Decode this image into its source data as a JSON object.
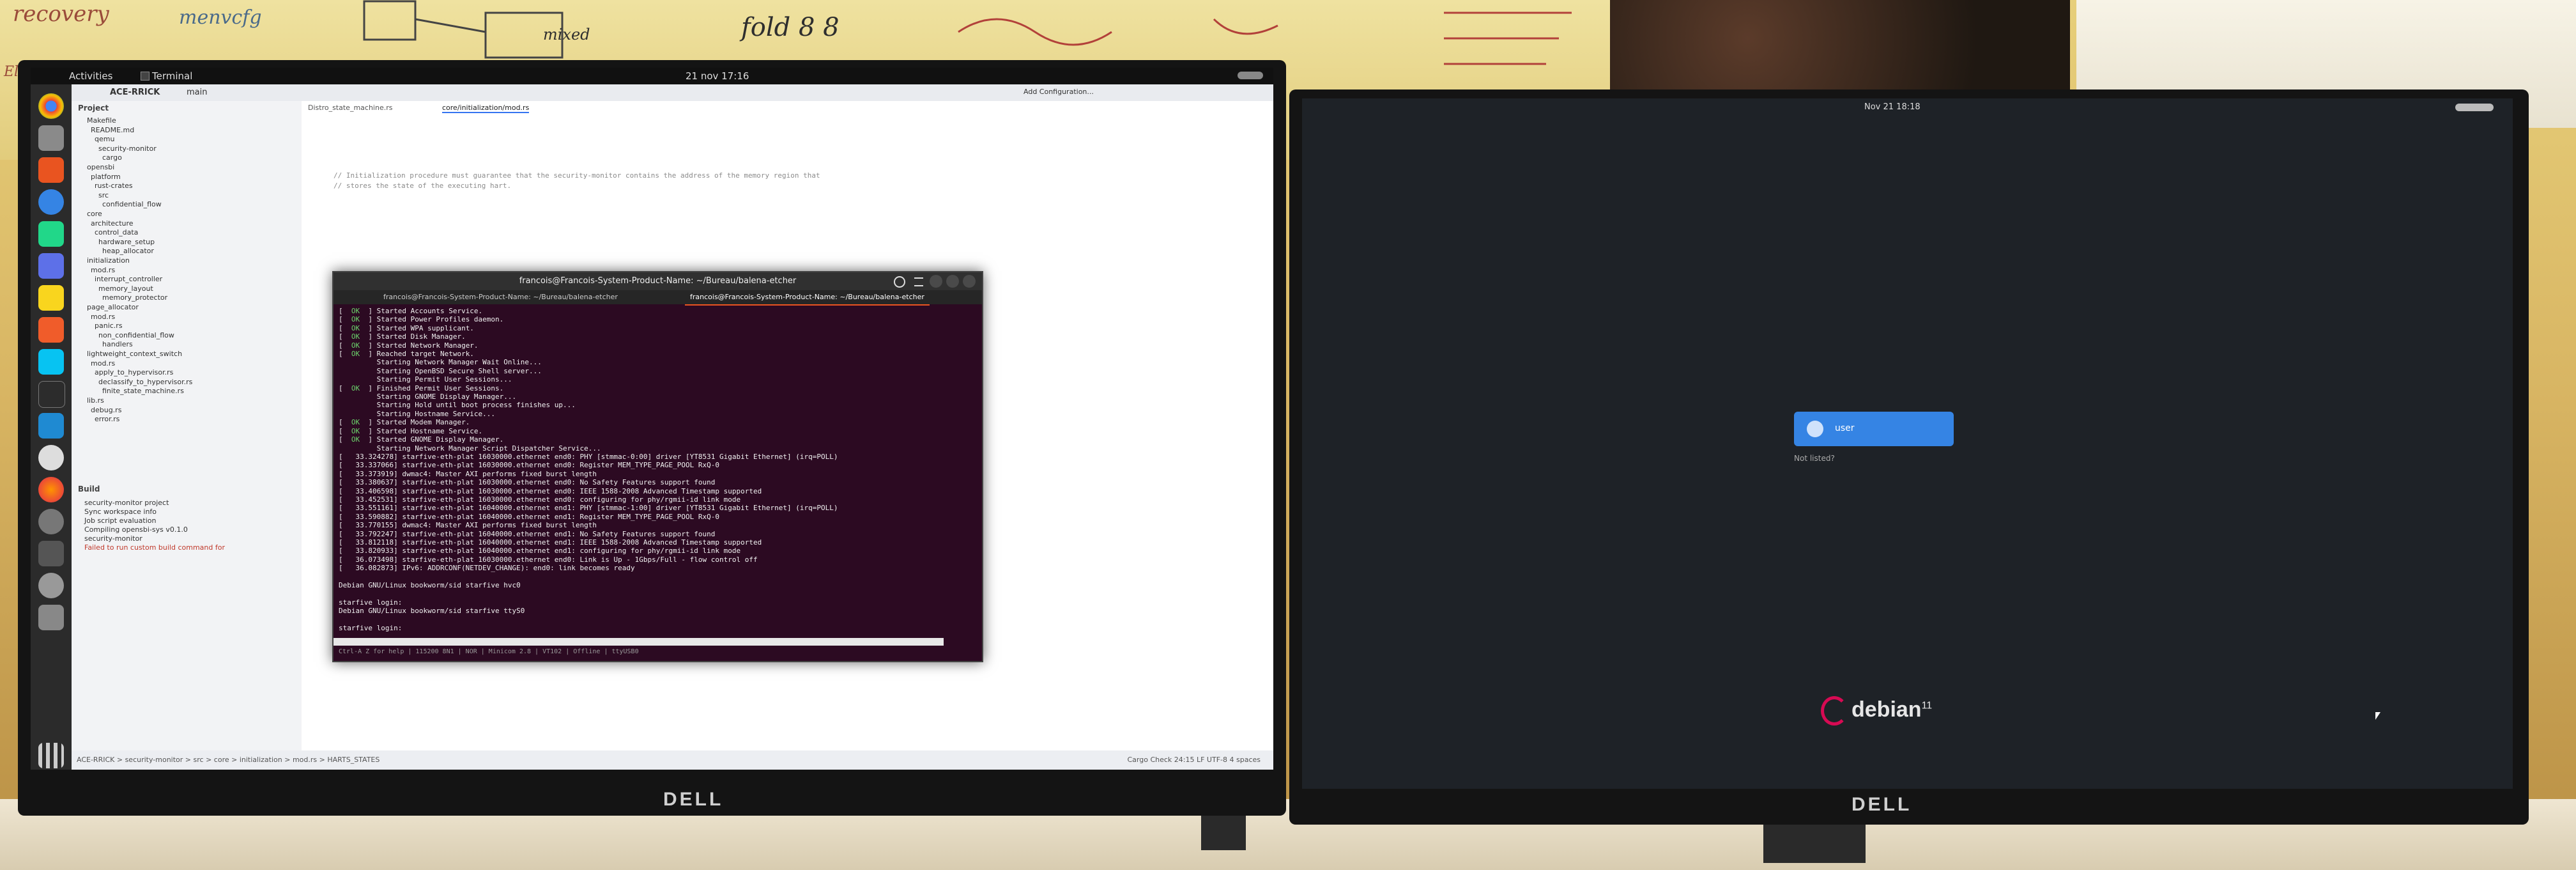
{
  "scene": {
    "whiteboard_notes": [
      "recovery",
      "menvcfg",
      "fold 8 8",
      "Elev",
      "mixed"
    ],
    "left_monitor_brand": "DELL",
    "right_monitor_brand": "DELL"
  },
  "left_screen": {
    "topbar": {
      "activities": "Activities",
      "app": "Terminal",
      "clock": "21 nov 17:16"
    },
    "ide": {
      "project_name": "ACE-RRICK",
      "branch": "main",
      "tabs": [
        "Distro_state_machine.rs",
        "core/initialization/mod.rs"
      ],
      "config": "Add Configuration...",
      "project_label": "Project",
      "tree": [
        "Makefile",
        "README.md",
        "qemu",
        "security-monitor",
        "cargo",
        "opensbi",
        "platform",
        "rust-crates",
        "src",
        "confidential_flow",
        "core",
        "architecture",
        "control_data",
        "hardware_setup",
        "heap_allocator",
        "initialization",
        "mod.rs",
        "interrupt_controller",
        "memory_layout",
        "memory_protector",
        "page_allocator",
        "mod.rs",
        "panic.rs",
        "non_confidential_flow",
        "handlers",
        "lightweight_context_switch",
        "mod.rs",
        "apply_to_hypervisor.rs",
        "declassify_to_hypervisor.rs",
        "finite_state_machine.rs",
        "lib.rs",
        "debug.rs",
        "error.rs"
      ],
      "build_label": "Build",
      "build_lines": [
        "security-monitor project",
        "Sync workspace info",
        "Job script evaluation",
        "Compiling opensbi-sys v0.1.0",
        "security-monitor",
        "Failed to run custom build command for"
      ],
      "editor_comment_1": "// Initialization procedure must guarantee that the security-monitor contains the address of the memory region that",
      "editor_comment_2": "// stores the state of the executing hart.",
      "breadcrumb": [
        "ACE-RRICK",
        "security-monitor",
        "src",
        "core",
        "initialization",
        "mod.rs",
        "HARTS_STATES"
      ],
      "status_right": "Cargo Check  24:15  LF  UTF-8  4 spaces"
    },
    "terminal": {
      "title": "francois@Francois-System-Product-Name: ~/Bureau/balena-etcher",
      "tab_1": "francois@Francois-System-Product-Name: ~/Bureau/balena-etcher",
      "tab_2": "francois@Francois-System-Product-Name: ~/Bureau/balena-etcher",
      "lines": [
        "[  OK  ] Started Accounts Service.",
        "[  OK  ] Started Power Profiles daemon.",
        "[  OK  ] Started WPA supplicant.",
        "[  OK  ] Started Disk Manager.",
        "[  OK  ] Started Network Manager.",
        "[  OK  ] Reached target Network.",
        "         Starting Network Manager Wait Online...",
        "         Starting OpenBSD Secure Shell server...",
        "         Starting Permit User Sessions...",
        "[  OK  ] Finished Permit User Sessions.",
        "         Starting GNOME Display Manager...",
        "         Starting Hold until boot process finishes up...",
        "         Starting Hostname Service...",
        "[  OK  ] Started Modem Manager.",
        "[  OK  ] Started Hostname Service.",
        "[  OK  ] Started GNOME Display Manager.",
        "         Starting Network Manager Script Dispatcher Service...",
        "[   33.324278] starfive-eth-plat 16030000.ethernet end0: PHY [stmmac-0:00] driver [YT8531 Gigabit Ethernet] (irq=POLL)",
        "[   33.337066] starfive-eth-plat 16030000.ethernet end0: Register MEM_TYPE_PAGE_POOL RxQ-0",
        "[   33.373919] dwmac4: Master AXI performs fixed burst length",
        "[   33.380637] starfive-eth-plat 16030000.ethernet end0: No Safety Features support found",
        "[   33.406598] starfive-eth-plat 16030000.ethernet end0: IEEE 1588-2008 Advanced Timestamp supported",
        "[   33.452531] starfive-eth-plat 16030000.ethernet end0: configuring for phy/rgmii-id link mode",
        "[   33.551161] starfive-eth-plat 16040000.ethernet end1: PHY [stmmac-1:00] driver [YT8531 Gigabit Ethernet] (irq=POLL)",
        "[   33.590882] starfive-eth-plat 16040000.ethernet end1: Register MEM_TYPE_PAGE_POOL RxQ-0",
        "[   33.770155] dwmac4: Master AXI performs fixed burst length",
        "[   33.792247] starfive-eth-plat 16040000.ethernet end1: No Safety Features support found",
        "[   33.812118] starfive-eth-plat 16040000.ethernet end1: IEEE 1588-2008 Advanced Timestamp supported",
        "[   33.820933] starfive-eth-plat 16040000.ethernet end1: configuring for phy/rgmii-id link mode",
        "[   36.073498] starfive-eth-plat 16030000.ethernet end0: Link is Up - 1Gbps/Full - flow control off",
        "[   36.082873] IPv6: ADDRCONF(NETDEV_CHANGE): end0: link becomes ready",
        "",
        "Debian GNU/Linux bookworm/sid starfive hvc0",
        "",
        "starfive login:",
        "Debian GNU/Linux bookworm/sid starfive ttyS0",
        "",
        "starfive login: "
      ],
      "footer": "Ctrl-A Z for help | 115200 8N1 | NOR | Minicom 2.8 | VT102 | Offline | ttyUSB0"
    }
  },
  "right_screen": {
    "clock": "Nov 21 18:18",
    "user_label": "user",
    "not_listed": "Not listed?",
    "logo_text": "debian",
    "logo_version": "11"
  }
}
